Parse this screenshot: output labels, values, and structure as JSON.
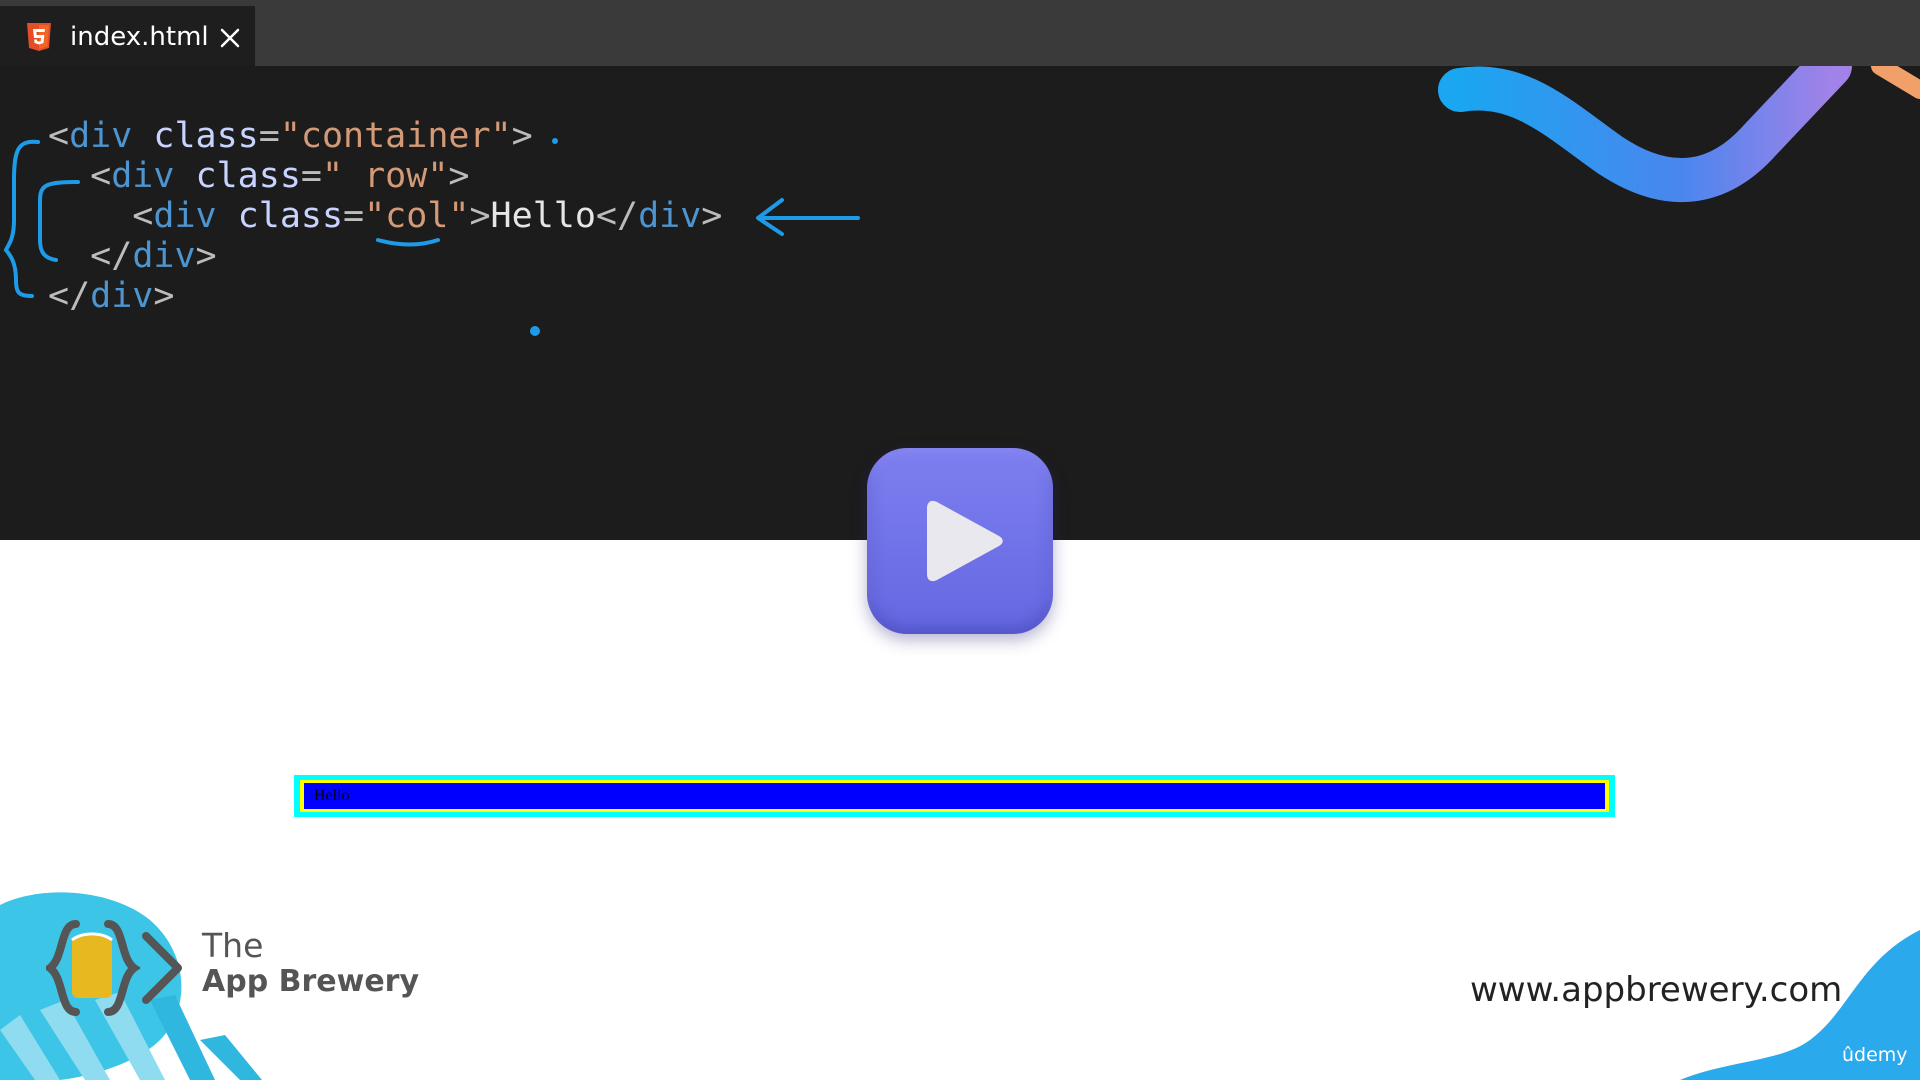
{
  "tab": {
    "title": "index.html"
  },
  "code": {
    "line1": {
      "open": "<",
      "tag": "div",
      "sp": " ",
      "attr": "class",
      "eq": "=",
      "val": "\"container\"",
      "close": ">"
    },
    "line2": {
      "indent": "  ",
      "open": "<",
      "tag": "div",
      "sp": " ",
      "attr": "class",
      "eq": "=",
      "val": "\" row\"",
      "close": ">"
    },
    "line3": {
      "indent": "    ",
      "open": "<",
      "tag": "div",
      "sp": " ",
      "attr": "class",
      "eq": "=",
      "val": "\"col\"",
      "close": ">",
      "text": "Hello",
      "endopen": "</",
      "endtag": "div",
      "endclose": ">"
    },
    "line4": {
      "indent": "  ",
      "open": "</",
      "tag": "div",
      "close": ">"
    },
    "line5": {
      "open": "</",
      "tag": "div",
      "close": ">"
    }
  },
  "preview": {
    "col_text": "Hello"
  },
  "brand": {
    "the": "The",
    "name": "App Brewery",
    "url": "www.appbrewery.com",
    "platform": "ûdemy"
  },
  "colors": {
    "editor_bg": "#1c1c1c",
    "tabbar_bg": "#3a3a3a",
    "annotation": "#1e9be8",
    "row_outer": "#00ffff",
    "row_inner": "#ffff00",
    "col_bg": "#0000ff",
    "play_button": "#6f72e8"
  },
  "icons": {
    "tab": "html5-icon",
    "close": "close-icon",
    "center": "play-icon"
  }
}
